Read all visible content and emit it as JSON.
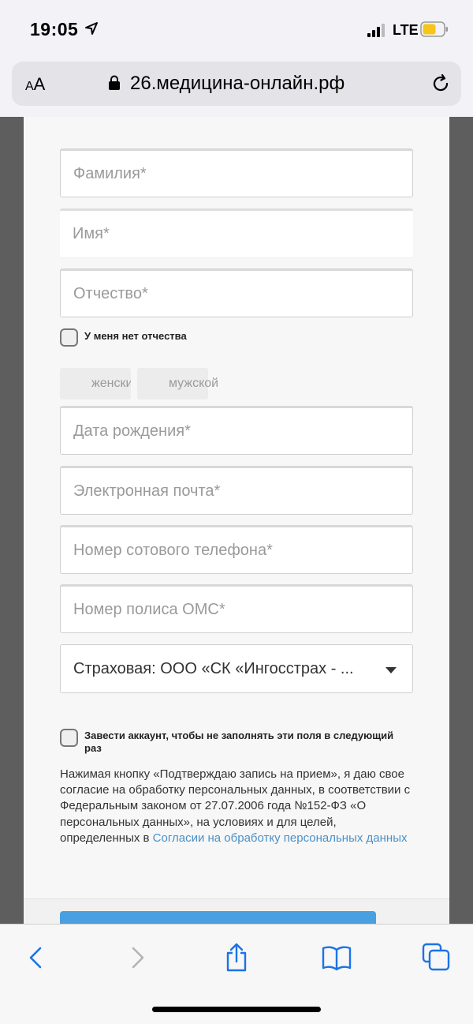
{
  "status": {
    "time": "19:05",
    "network": "LTE"
  },
  "browser": {
    "text_size": "AA",
    "url": "26.медицина-онлайн.рф"
  },
  "form": {
    "last_name_placeholder": "Фамилия*",
    "first_name_placeholder": "Имя*",
    "middle_name_placeholder": "Отчество*",
    "no_middle_name_label": "У меня нет отчества",
    "gender_female": "женский",
    "gender_male": "мужской",
    "birth_date_placeholder": "Дата рождения*",
    "email_placeholder": "Электронная почта*",
    "phone_placeholder": "Номер сотового телефона*",
    "oms_placeholder": "Номер полиса ОМС*",
    "insurance_value": "Страховая: ООО «СК «Ингосстрах - ...",
    "create_account_label_1": "Завести аккаунт, чтобы не заполнять эти поля в следующий",
    "create_account_label_2": "раз",
    "consent_text": "Нажимая кнопку «Подтверждаю запись на прием», я даю свое согласие на обработку персональных данных, в соответствии с Федеральным законом от 27.07.2006 года №152-ФЗ «О персональных данных», на условиях и для целей, определенных в ",
    "consent_link": "Согласии на обработку персональных данных"
  },
  "toolbar": {
    "back": "chevron-left-icon",
    "forward": "chevron-right-icon",
    "share": "share-icon",
    "bookmarks": "book-icon",
    "tabs": "tabs-icon"
  },
  "colors": {
    "link": "#4a90c8",
    "button": "#4a9fe0",
    "toolbar_icon": "#1a73e8"
  }
}
